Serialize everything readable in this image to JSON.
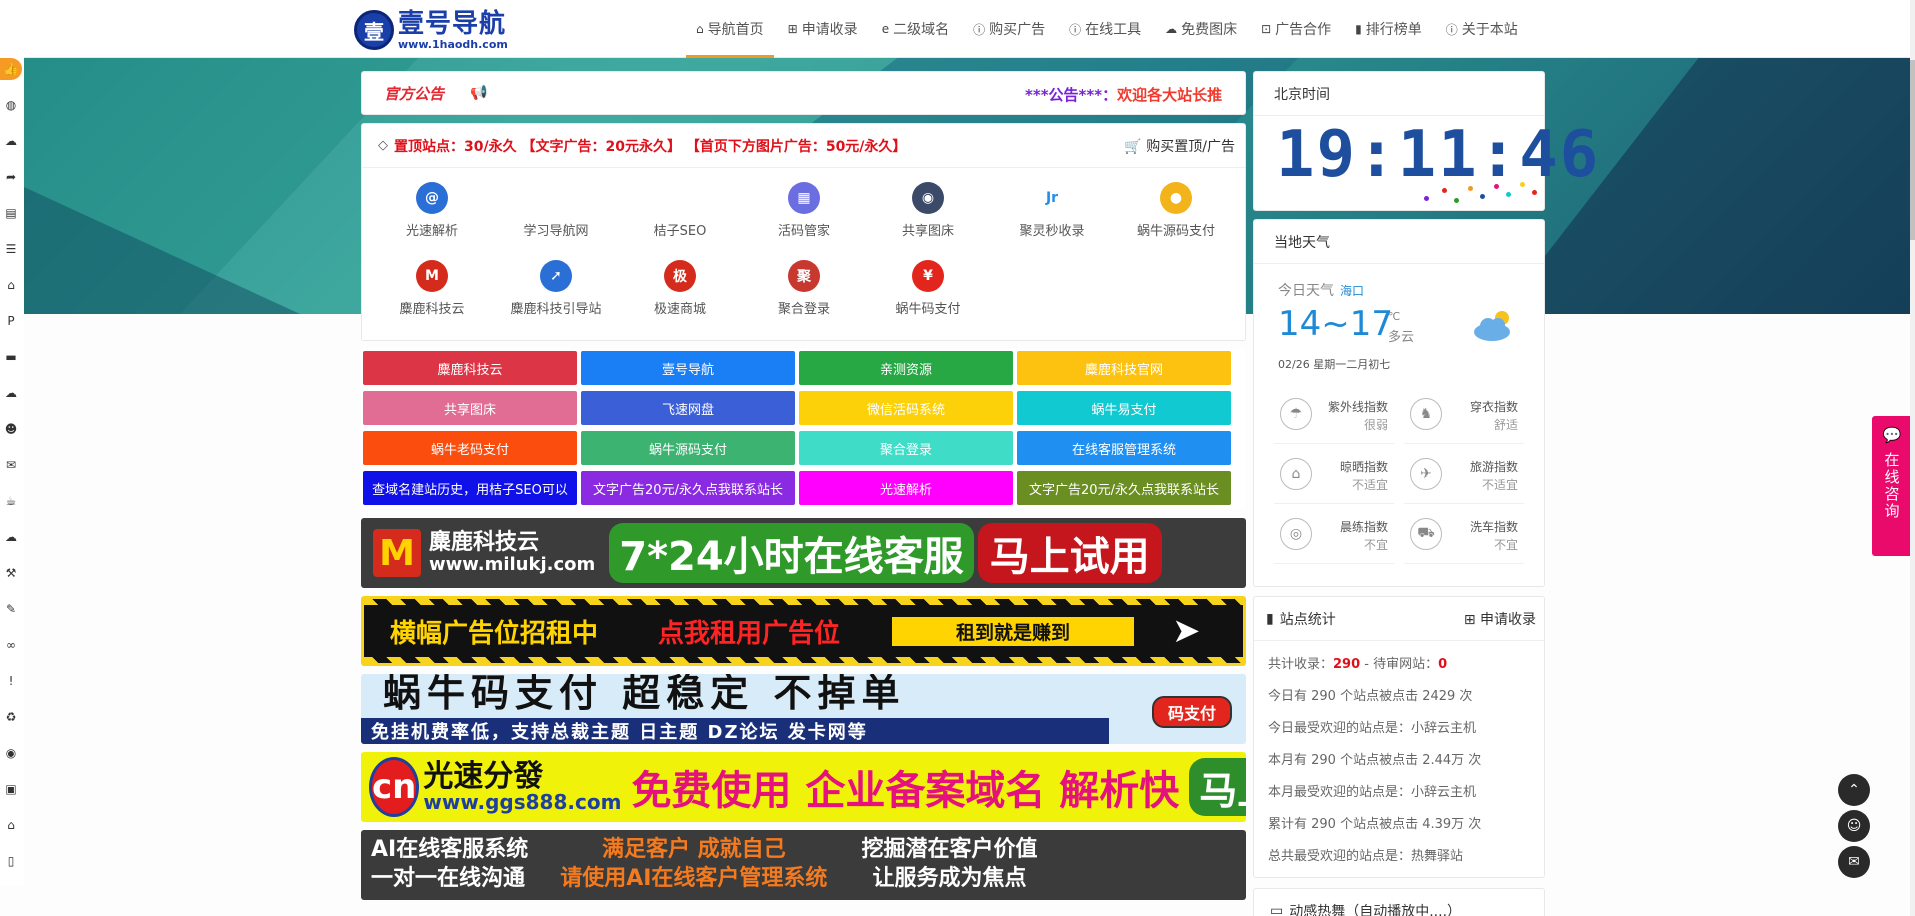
{
  "logo": {
    "cn": "壹号导航",
    "url": "www.1haodh.com",
    "mark": "壹"
  },
  "nav": [
    {
      "icon": "⌂",
      "label": "导航首页"
    },
    {
      "icon": "⊞",
      "label": "申请收录"
    },
    {
      "icon": "e",
      "label": "二级域名"
    },
    {
      "icon": "ⓘ",
      "label": "购买广告"
    },
    {
      "icon": "ⓘ",
      "label": "在线工具"
    },
    {
      "icon": "☁",
      "label": "免费图床"
    },
    {
      "icon": "⊡",
      "label": "广告合作"
    },
    {
      "icon": "▮",
      "label": "排行榜单"
    },
    {
      "icon": "ⓘ",
      "label": "关于本站"
    }
  ],
  "notice": {
    "badge": "官方公告",
    "text_a": "***公告***：",
    "text_b": "欢迎各大站长推"
  },
  "sites_head": {
    "text": "置顶站点：30/永久 【文字广告：20元永久】 【首页下方图片广告：50元/永久】",
    "buy": "购买置顶/广告"
  },
  "sites": [
    {
      "label": "光速解析",
      "color": "#2a6fd6",
      "glyph": "@"
    },
    {
      "label": "学习导航网",
      "color": "",
      "glyph": ""
    },
    {
      "label": "桔子SEO",
      "color": "",
      "glyph": ""
    },
    {
      "label": "活码管家",
      "color": "#6a6ee0",
      "glyph": "▦"
    },
    {
      "label": "共享图床",
      "color": "#3c4a6a",
      "glyph": "◉"
    },
    {
      "label": "聚灵秒收录",
      "color": "#ffffff",
      "glyph": "Jr"
    },
    {
      "label": "蜗牛源码支付",
      "color": "#f2b31b",
      "glyph": "●"
    },
    {
      "label": "麋鹿科技云",
      "color": "#d42b1c",
      "glyph": "M"
    },
    {
      "label": "麋鹿科技引导站",
      "color": "#2a6fd6",
      "glyph": "➚"
    },
    {
      "label": "极速商城",
      "color": "#d42b1c",
      "glyph": "极"
    },
    {
      "label": "聚合登录",
      "color": "#c7382f",
      "glyph": "聚"
    },
    {
      "label": "蜗牛码支付",
      "color": "#e3261d",
      "glyph": "¥"
    }
  ],
  "tags": [
    {
      "label": "麋鹿科技云",
      "color": "#dc3545"
    },
    {
      "label": "壹号导航",
      "color": "#1a7ef4"
    },
    {
      "label": "亲测资源",
      "color": "#28a745"
    },
    {
      "label": "麋鹿科技官网",
      "color": "#fdc210"
    },
    {
      "label": "共享图床",
      "color": "#e26d94"
    },
    {
      "label": "飞速网盘",
      "color": "#3a5fd6"
    },
    {
      "label": "微信活码系统",
      "color": "#fdd10a"
    },
    {
      "label": "蜗牛易支付",
      "color": "#11c9d0"
    },
    {
      "label": "蜗牛老码支付",
      "color": "#fa4d0e"
    },
    {
      "label": "蜗牛源码支付",
      "color": "#3cb371"
    },
    {
      "label": "聚合登录",
      "color": "#3fdcc7"
    },
    {
      "label": "在线客服管理系统",
      "color": "#1f8ff2"
    },
    {
      "label": "查域名建站历史，用桔子SEO可以",
      "color": "#1010e8"
    },
    {
      "label": "文字广告20元/永久点我联系站长",
      "color": "#8a2be2"
    },
    {
      "label": "光速解析",
      "color": "#ff00ff"
    },
    {
      "label": "文字广告20元/永久点我联系站长",
      "color": "#6b8e23"
    }
  ],
  "banners": {
    "b1": {
      "logo": "M",
      "title": "麋鹿科技云",
      "url": "www.milukj.com",
      "mid": "7*24小时在线客服",
      "cta": "马上试用"
    },
    "b2": {
      "t1": "横幅广告位招租中",
      "t2": "点我租用广告位",
      "t3": "租到就是赚到"
    },
    "b3": {
      "t1": "蜗牛码支付 超稳定 不掉单",
      "t2": "免挂机费率低，支持总裁主题 日主题 DZ论坛 发卡网等",
      "pay": "码支付"
    },
    "b4": {
      "logo": "cn",
      "title": "光速分發",
      "url": "www.ggs888.com",
      "mid": "免费使用 企业备案域名 解析快",
      "cta": "马上体验"
    },
    "b5": {
      "l1": "AI在线客服系统",
      "l2": "一对一在线沟通",
      "m1": "满足客户  成就自己",
      "m2": "请使用AI在线客户管理系统",
      "r1": "挖掘潜在客户价值",
      "r2": "让服务成为焦点"
    }
  },
  "time": {
    "title": "北京时间",
    "clock": "19:11:46"
  },
  "weather": {
    "title": "当地天气",
    "today": "今日天气",
    "city": "海口",
    "temp": "14~17",
    "unit": "℃",
    "desc": "多云",
    "date": "02/26 星期一二月初七",
    "indices": [
      {
        "name": "紫外线指数",
        "value": "很弱",
        "icon": "☂"
      },
      {
        "name": "穿衣指数",
        "value": "舒适",
        "icon": "♞"
      },
      {
        "name": "晾晒指数",
        "value": "不适宜",
        "icon": "⌂"
      },
      {
        "name": "旅游指数",
        "value": "不适宜",
        "icon": "✈"
      },
      {
        "name": "晨练指数",
        "value": "不宜",
        "icon": "◎"
      },
      {
        "name": "洗车指数",
        "value": "不宜",
        "icon": "⛟"
      }
    ]
  },
  "stats": {
    "title": "站点统计",
    "apply": "申请收录",
    "total_label": "共计收录：",
    "total": "290",
    "sep": " - ",
    "pending_label": "待审网站：",
    "pending": "0",
    "lines": [
      "今日有 290 个站点被点击 2429 次",
      "今日最受欢迎的站点是：小辞云主机",
      "本月有 290 个站点被点击 2.44万 次",
      "本月最受欢迎的站点是：小辞云主机",
      "累计有 290 个站点被点击 4.39万 次",
      "总共最受欢迎的站点是：热舞驿站"
    ]
  },
  "dynamic": {
    "title": "动感热舞（自动播放中....）"
  },
  "consult": {
    "label": "在线咨询"
  }
}
